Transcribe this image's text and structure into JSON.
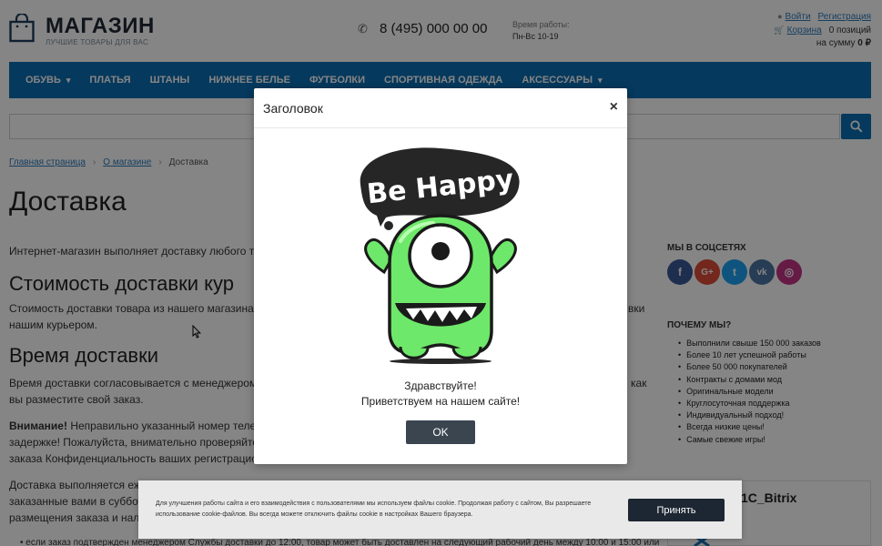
{
  "header": {
    "logo_title": "МАГАЗИН",
    "logo_subtitle": "ЛУЧШИЕ ТОВАРЫ ДЛЯ ВАС",
    "phone": "8 (495) 000 00 00",
    "hours_label": "Время работы:",
    "hours_value": "Пн-Вс 10-19",
    "login": "Войти",
    "register": "Регистрация",
    "cart": "Корзина",
    "cart_count": "0 позиций",
    "cart_sum_label": "на сумму",
    "cart_sum_value": "0 ₽"
  },
  "nav": {
    "items": [
      {
        "label": "ОБУВЬ",
        "dropdown": true
      },
      {
        "label": "ПЛАТЬЯ",
        "dropdown": false
      },
      {
        "label": "ШТАНЫ",
        "dropdown": false
      },
      {
        "label": "НИЖНЕЕ БЕЛЬЕ",
        "dropdown": false
      },
      {
        "label": "ФУТБОЛКИ",
        "dropdown": false
      },
      {
        "label": "СПОРТИВНАЯ ОДЕЖДА",
        "dropdown": false
      },
      {
        "label": "АКСЕССУАРЫ",
        "dropdown": true
      }
    ]
  },
  "search": {
    "placeholder": ""
  },
  "breadcrumb": {
    "home": "Главная страница",
    "about": "О магазине",
    "current": "Доставка"
  },
  "content": {
    "title": "Доставка",
    "intro": "Интернет-магазин выполняет доставку любого то",
    "h_cost": "Стоимость доставки кур",
    "cost_text_1": "Стоимость доставки товара из нашего магазина",
    "cost_text_1_tail": "вки",
    "cost_text_2": "нашим курьером.",
    "h_time": "Время доставки",
    "time_text_1": "Время доставки согласовывается с менеджером",
    "time_text_1_tail": "как",
    "time_text_2": "вы разместите свой заказ.",
    "warn_bold": "Внимание!",
    "warn_text": " Неправильно указанный номер телес",
    "warn_text_2": "задержке! Пожалуйста, внимательно проверяйте",
    "warn_text_3": "заказа Конфиденциальность ваших регистрацио",
    "extra_1": "Доставка выполняется еж",
    "extra_2": "заказанные вами в суббот",
    "extra_3": "размещения заказа и нал",
    "bullet_1": "если заказ подтвержден менеджером Службы доставки до 12:00, товар может быть доставлен на следующий рабочий день между 10:00 и 15:00 или"
  },
  "sidebar": {
    "social_title": "МЫ В СОЦСЕТЯХ",
    "socials": [
      {
        "name": "facebook",
        "glyph": "f",
        "color": "#3b5998"
      },
      {
        "name": "google-plus",
        "glyph": "G+",
        "color": "#dd4b39"
      },
      {
        "name": "twitter",
        "glyph": "t",
        "color": "#1da1f2"
      },
      {
        "name": "vk",
        "glyph": "vk",
        "color": "#4c75a3"
      },
      {
        "name": "instagram",
        "glyph": "◎",
        "color": "#c13584"
      }
    ],
    "why_title": "ПОЧЕМУ МЫ?",
    "why_items": [
      "Выполнили свыше 150 000 заказов",
      "Более 10 лет успешной работы",
      "Более 50 000 покупателей",
      "Контракты с домами мод",
      "Оригинальные модели",
      "Круглосуточная поддержка",
      "Индивидуальный подход!",
      "Всегда низкие цены!",
      "Самые свежие игры!"
    ],
    "widget_title": "1C_Bitrix"
  },
  "modal": {
    "title": "Заголовок",
    "close": "×",
    "image_text": "Be Happy",
    "line1": "Здравствуйте!",
    "line2": "Приветствуем на нашем сайте!",
    "ok": "OK"
  },
  "cookie": {
    "text": "Для улучшения работы сайта и его взаимодействия с пользователями мы используем файлы cookie. Продолжая работу с сайтом, Вы разрешаете использование cookie-файлов. Вы всегда можете отключить файлы cookie в настройках Вашего браузера.",
    "accept": "Принять"
  },
  "colors": {
    "brand_blue": "#0b6db3",
    "dark_button": "#3a4550",
    "monster_green": "#6ee86a"
  }
}
